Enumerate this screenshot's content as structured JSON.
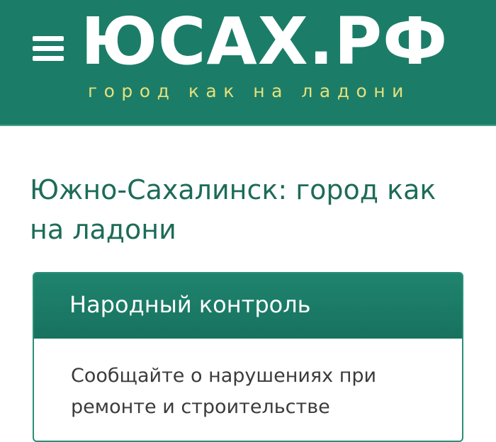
{
  "header": {
    "logo": "ЮСАХ.РФ",
    "tagline": "город как на ладони",
    "background_color": "#1b7d68",
    "tagline_color": "#e8e07a",
    "menu_icon": "hamburger-menu-icon"
  },
  "main": {
    "title": "Южно-Сахалинск: город как на ладони",
    "title_color": "#1d6b58"
  },
  "card": {
    "title": "Народный контроль",
    "text": "Сообщайте о нарушениях при ремонте и строительстве"
  }
}
